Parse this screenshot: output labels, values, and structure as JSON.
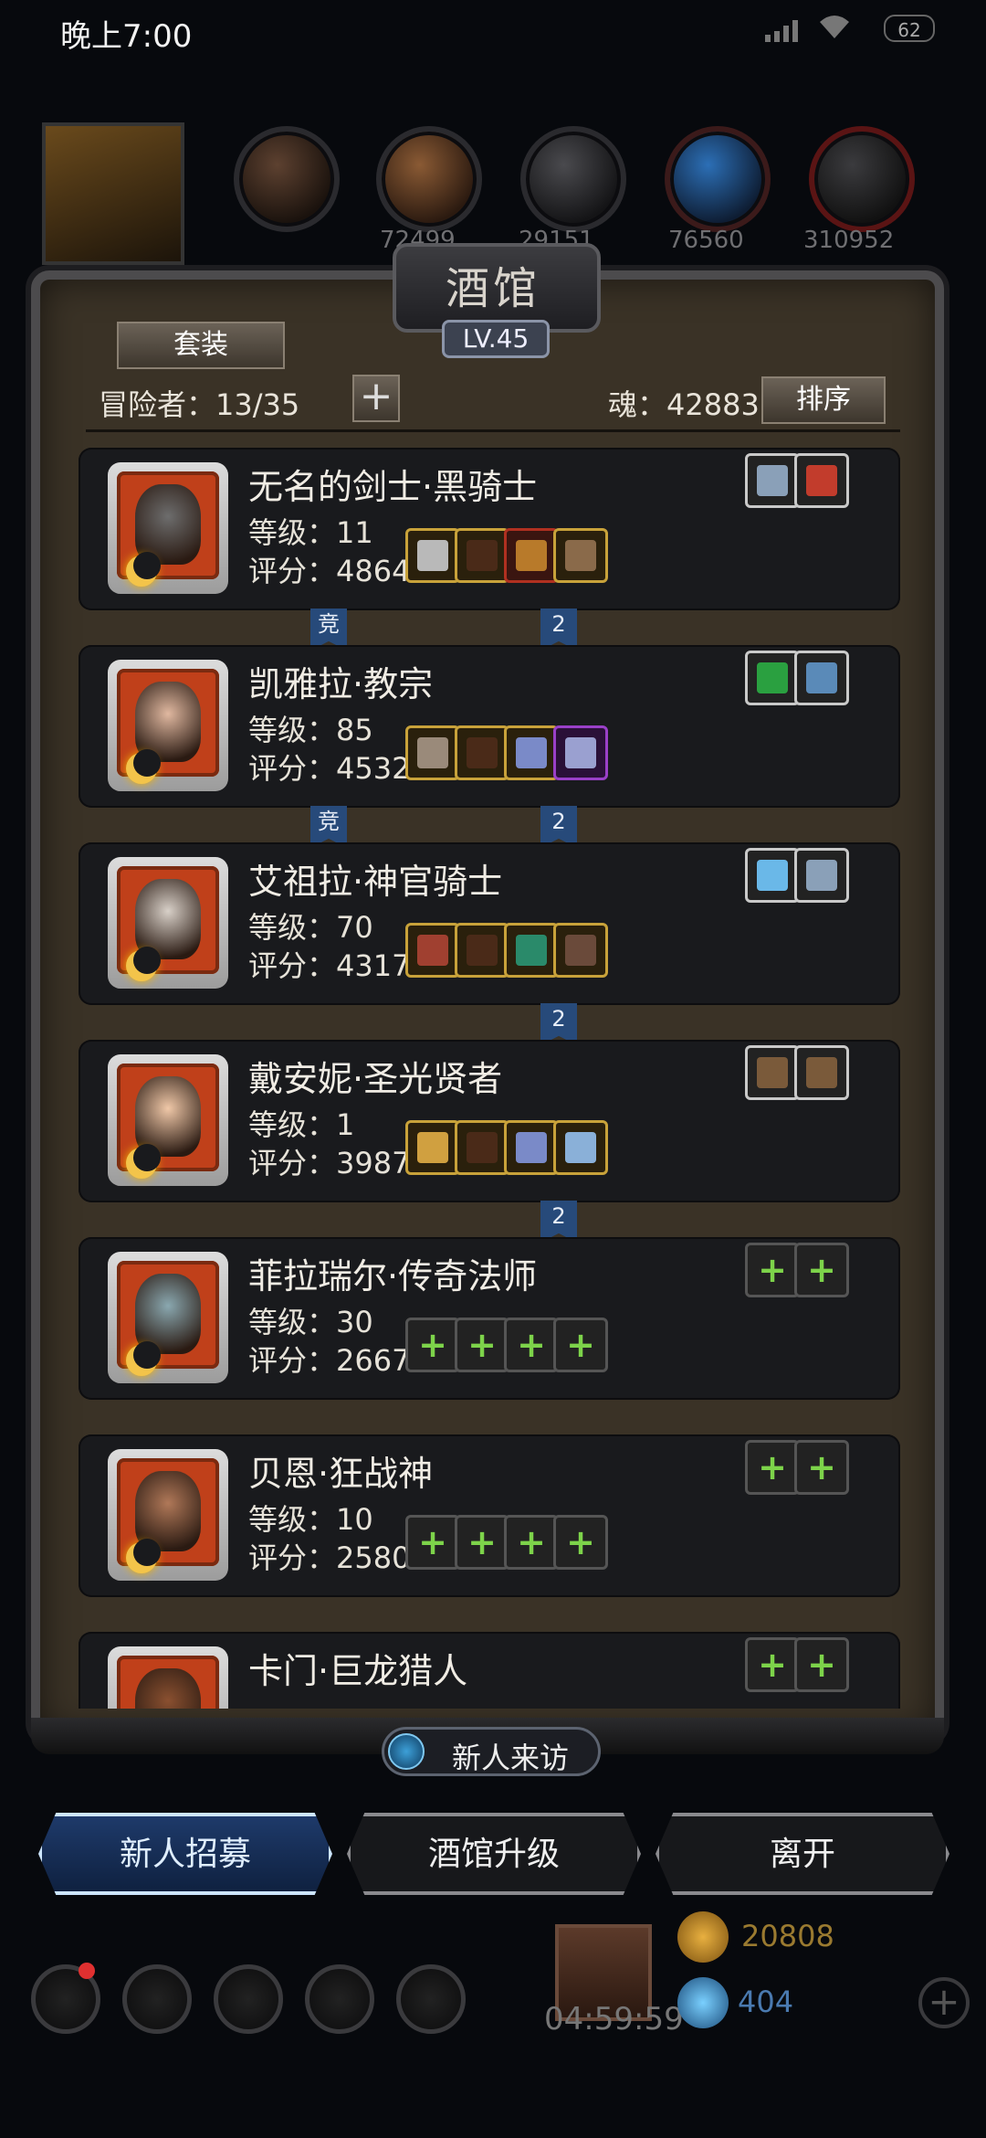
{
  "status": {
    "time": "晚上7:00",
    "battery": "62"
  },
  "resources": [
    "",
    "",
    "72499",
    "29151",
    "76560",
    "310952"
  ],
  "panel": {
    "title": "酒馆",
    "level": "LV.45",
    "tab": "套装",
    "adventurers": "冒险者：13/35",
    "souls": "魂：42883",
    "sort_label": "排序"
  },
  "heroes": [
    {
      "name": "无名的剑士·黑骑士",
      "level": "等级：11",
      "score": "评分：4864",
      "face": "#6d6d6d",
      "ribbon_left": "竞",
      "ribbon_right": "2",
      "slots_top": [
        {
          "t": "silver",
          "c": "#8aa0b8"
        },
        {
          "t": "silver",
          "c": "#c23c2c"
        }
      ],
      "slots_bottom": [
        {
          "t": "gold",
          "c": "#b9b9b9"
        },
        {
          "t": "gold",
          "c": "#4a2a18"
        },
        {
          "t": "red",
          "c": "#b87a2a"
        },
        {
          "t": "gold",
          "c": "#8a6a4a"
        }
      ]
    },
    {
      "name": "凯雅拉·教宗",
      "level": "等级：85",
      "score": "评分：4532",
      "face": "#e0b8a0",
      "ribbon_left": "竞",
      "ribbon_right": "2",
      "slots_top": [
        {
          "t": "silver",
          "c": "#2aa040"
        },
        {
          "t": "silver",
          "c": "#5a8ab8"
        }
      ],
      "slots_bottom": [
        {
          "t": "gold",
          "c": "#9a8a7a"
        },
        {
          "t": "gold",
          "c": "#4a2a18"
        },
        {
          "t": "gold",
          "c": "#7a8ac8"
        },
        {
          "t": "purple",
          "c": "#9aa0d0"
        }
      ]
    },
    {
      "name": "艾祖拉·神官骑士",
      "level": "等级：70",
      "score": "评分：4317",
      "face": "#d8d0c8",
      "ribbon_left": "",
      "ribbon_right": "2",
      "slots_top": [
        {
          "t": "silver",
          "c": "#6ab8e8"
        },
        {
          "t": "silver",
          "c": "#8aa0b8"
        }
      ],
      "slots_bottom": [
        {
          "t": "gold",
          "c": "#a04030"
        },
        {
          "t": "gold",
          "c": "#4a2a18"
        },
        {
          "t": "gold",
          "c": "#2a8a6a"
        },
        {
          "t": "gold",
          "c": "#6a4a3a"
        }
      ]
    },
    {
      "name": "戴安妮·圣光贤者",
      "level": "等级：1",
      "score": "评分：3987",
      "face": "#f0c8a8",
      "ribbon_left": "",
      "ribbon_right": "2",
      "slots_top": [
        {
          "t": "silver",
          "c": "#7a5a3a"
        },
        {
          "t": "silver",
          "c": "#7a5a3a"
        }
      ],
      "slots_bottom": [
        {
          "t": "gold",
          "c": "#d0a040"
        },
        {
          "t": "gold",
          "c": "#4a2a18"
        },
        {
          "t": "gold",
          "c": "#7a8ac8"
        },
        {
          "t": "gold",
          "c": "#8ab0d8"
        }
      ]
    },
    {
      "name": "菲拉瑞尔·传奇法师",
      "level": "等级：30",
      "score": "评分：2667",
      "face": "#8aa8b0",
      "ribbon_left": "",
      "ribbon_right": "",
      "slots_top": [
        {
          "t": "empty",
          "c": ""
        },
        {
          "t": "empty",
          "c": ""
        }
      ],
      "slots_bottom": [
        {
          "t": "empty",
          "c": ""
        },
        {
          "t": "empty",
          "c": ""
        },
        {
          "t": "empty",
          "c": ""
        },
        {
          "t": "empty",
          "c": ""
        }
      ]
    },
    {
      "name": "贝恩·狂战神",
      "level": "等级：10",
      "score": "评分：2580",
      "face": "#b07858",
      "ribbon_left": "",
      "ribbon_right": "",
      "slots_top": [
        {
          "t": "empty",
          "c": ""
        },
        {
          "t": "empty",
          "c": ""
        }
      ],
      "slots_bottom": [
        {
          "t": "empty",
          "c": ""
        },
        {
          "t": "empty",
          "c": ""
        },
        {
          "t": "empty",
          "c": ""
        },
        {
          "t": "empty",
          "c": ""
        }
      ]
    },
    {
      "name": "卡门·巨龙猎人",
      "level": "",
      "score": "",
      "face": "#8a5030",
      "ribbon_left": "",
      "ribbon_right": "",
      "slots_top": [
        {
          "t": "empty",
          "c": ""
        },
        {
          "t": "empty",
          "c": ""
        }
      ],
      "slots_bottom": []
    }
  ],
  "visitor": {
    "label": "新人来访"
  },
  "actions": {
    "recruit": "新人招募",
    "upgrade": "酒馆升级",
    "leave": "离开"
  },
  "bottom": {
    "timer": "04:59:59",
    "gold": "20808",
    "gems": "404"
  },
  "colors": {
    "accent_blue": "#5fb3ff",
    "gold": "#c8a23a",
    "plus_green": "#7dd34a",
    "ribbon": "#274a7a"
  }
}
